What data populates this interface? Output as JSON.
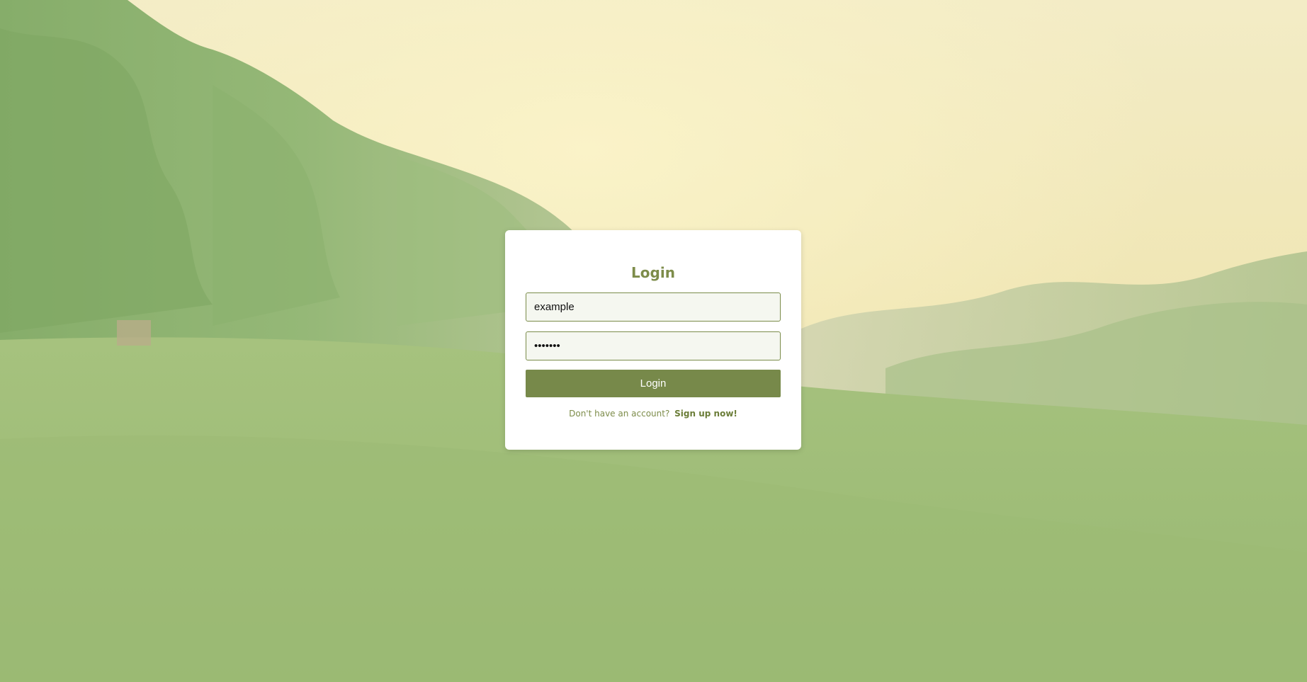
{
  "login": {
    "title": "Login",
    "username_value": "example",
    "password_value": "example",
    "submit_label": "Login",
    "signup_prompt": "Don't have an account?",
    "signup_link": "Sign up now!"
  },
  "colors": {
    "accent": "#77894a",
    "title": "#7d8c4a",
    "card": "#ffffff"
  }
}
